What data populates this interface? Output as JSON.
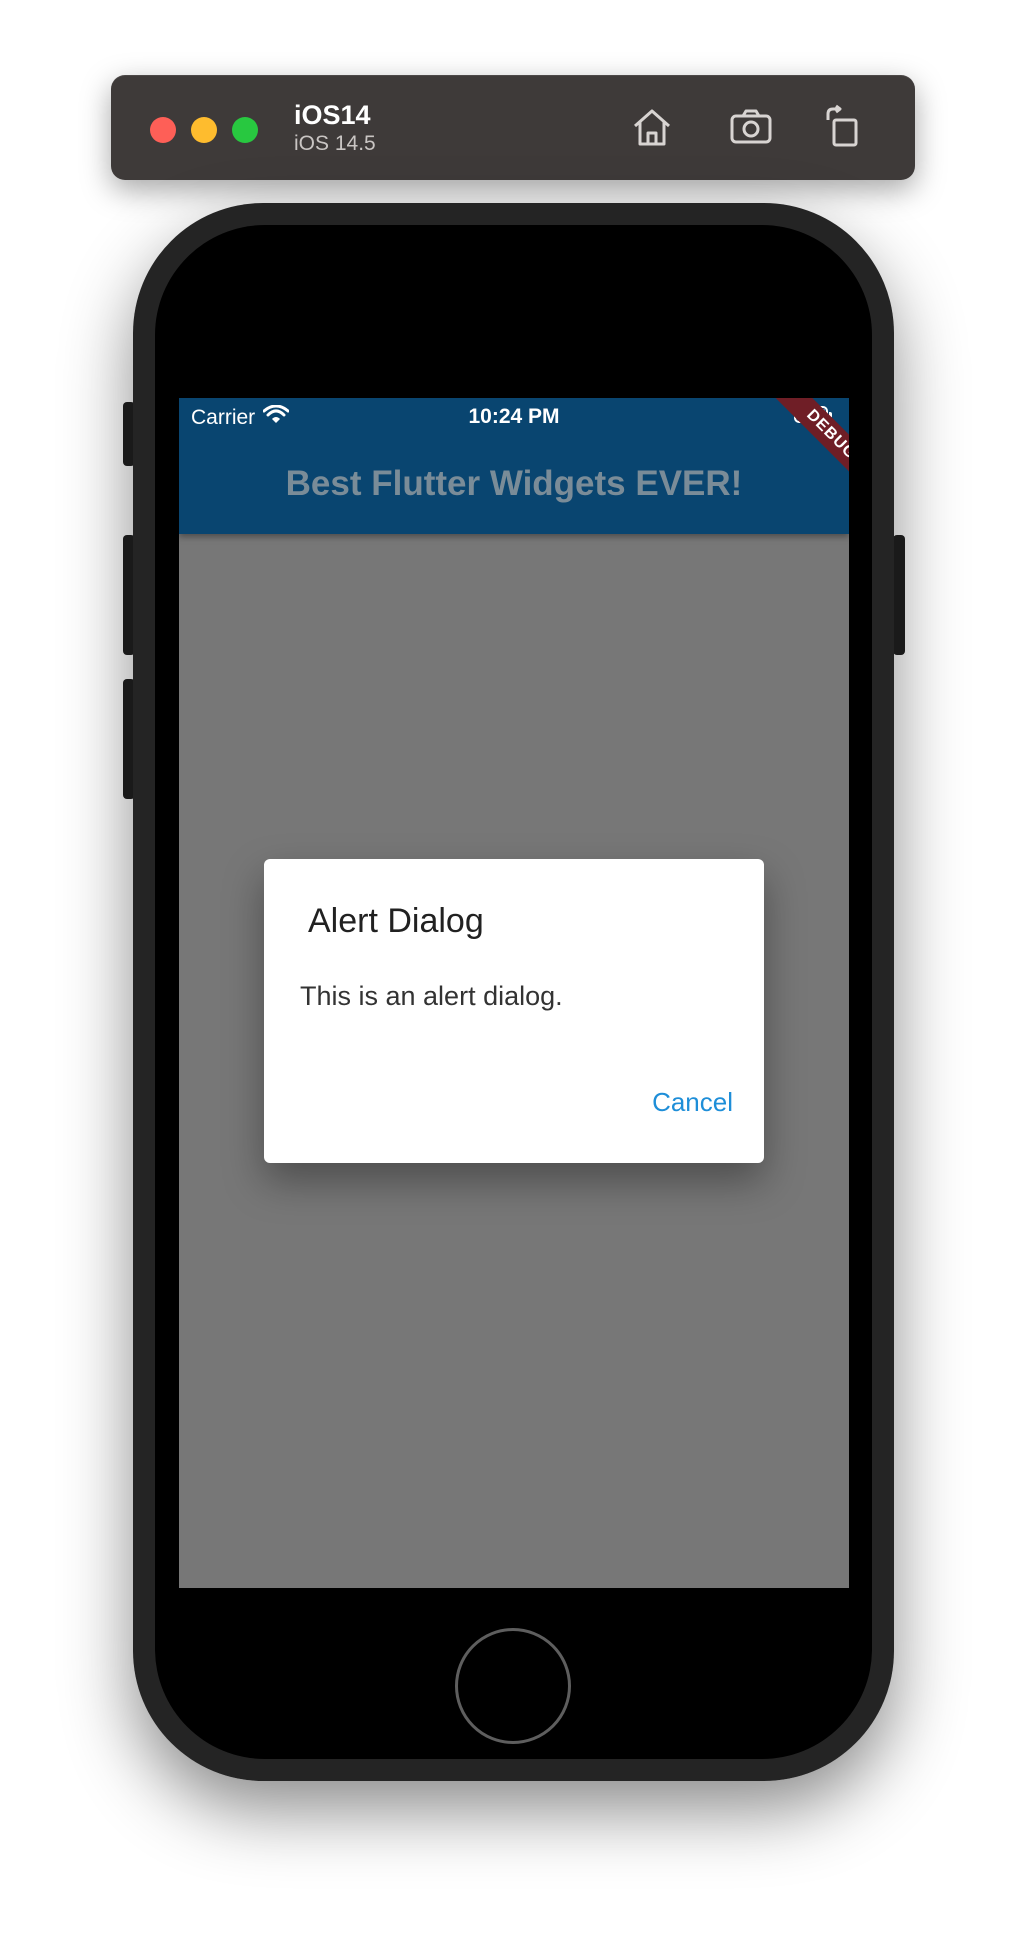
{
  "simulator": {
    "device_name": "iOS14",
    "os_version": "iOS 14.5",
    "toolbar_icons": [
      "home-icon",
      "screenshot-icon",
      "rotate-icon"
    ],
    "traffic_lights": {
      "close": "#fe5f57",
      "minimize": "#febc2e",
      "zoom": "#28c840"
    }
  },
  "status_bar": {
    "carrier": "Carrier",
    "time": "10:24 PM",
    "wifi_icon": "wifi-icon",
    "battery_icon": "battery-icon"
  },
  "app_bar": {
    "title": "Best Flutter Widgets EVER!",
    "background": "#094570",
    "debug_banner": "DEBUG"
  },
  "dialog": {
    "title": "Alert Dialog",
    "content": "This is an alert dialog.",
    "cancel_label": "Cancel",
    "accent": "#1e8ed8"
  },
  "colors": {
    "scrim": "#777777",
    "toolbar": "#3e3a39"
  }
}
